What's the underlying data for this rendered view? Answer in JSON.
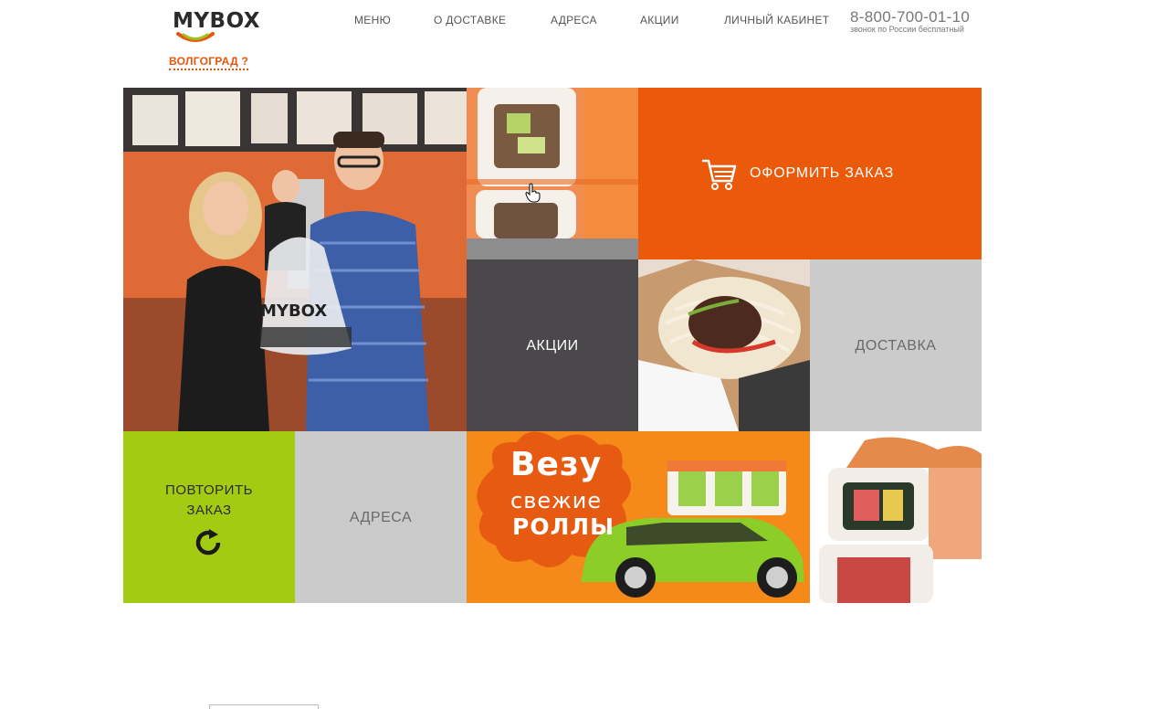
{
  "header": {
    "logo_text": "MYBOX",
    "nav": {
      "menu": "МЕНЮ",
      "delivery_info": "О ДОСТАВКЕ",
      "addresses": "АДРЕСА",
      "promotions": "АКЦИИ",
      "account": "ЛИЧНЫЙ КАБИНЕТ"
    },
    "phone": "8-800-700-01-10",
    "phone_note": "звонок по России бесплатный",
    "city": "ВОЛГОГРАД ?"
  },
  "tiles": {
    "order": "ОФОРМИТЬ ЗАКАЗ",
    "promotions": "АКЦИИ",
    "delivery": "ДОСТАВКА",
    "repeat_line1": "ПОВТОРИТЬ",
    "repeat_line2": "ЗАКАЗ",
    "addresses": "АДРЕСА"
  },
  "banner": {
    "word1": "Везу",
    "word2": "свежие",
    "word3": "РОЛЛЫ"
  },
  "photo_bag_text": "MYBOX",
  "icons": [
    "cart-icon",
    "repeat-icon",
    "hand-cursor-icon"
  ],
  "colors": {
    "accent_orange": "#eb5a0b",
    "green": "#a3cb12",
    "dark_gray": "#4a484a",
    "light_gray": "#cbcbcb"
  }
}
